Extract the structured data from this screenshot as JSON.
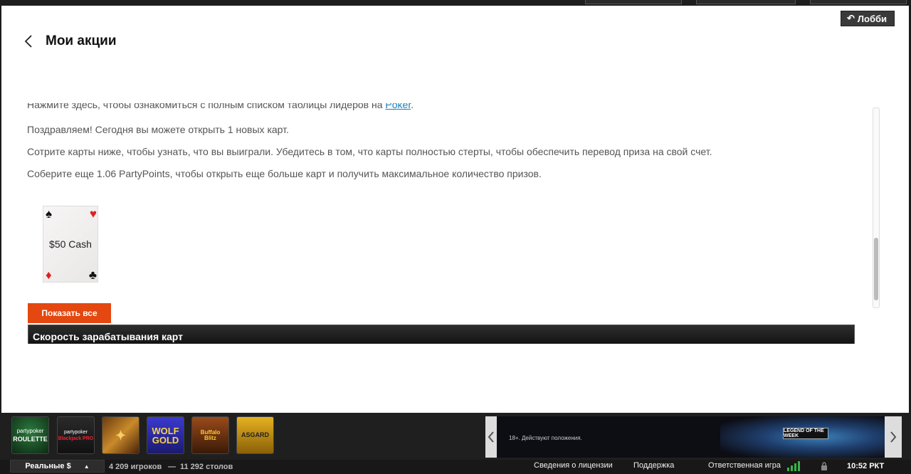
{
  "header": {
    "lobby_label": "Лобби",
    "title": "Мои акции"
  },
  "content": {
    "leaderboard_text": "Нажмите здесь, чтобы ознакомиться с полным списком таблицы лидеров на ",
    "leaderboard_link": "Poker",
    "leaderboard_suffix": ".",
    "congrats": "Поздравляем! Сегодня вы можете открыть 1 новых карт.",
    "instructions": "Сотрите карты ниже, чтобы узнать, что вы выиграли. Убедитесь в том, что карты полностью стерты, чтобы обеспечить перевод приза на свой счет.",
    "collect_more": "Соберите еще 1.06 PartyPoints, чтобы открыть еще больше карт и получить максимальное количество призов.",
    "card_prize": "$50 Cash",
    "show_all_label": "Показать все",
    "section_title": "Скорость зарабатывания карт"
  },
  "games": [
    {
      "name": "partypoker ROULETTE",
      "line1": "partypoker",
      "line2": "ROULETTE",
      "icon": "roulette-icon"
    },
    {
      "name": "partypoker Blackjack PRO",
      "line1": "partypoker",
      "line2": "Blackjack PRO",
      "icon": "blackjack-icon"
    },
    {
      "name": "slot-game-3",
      "line1": "",
      "line2": "",
      "icon": "slot-icon"
    },
    {
      "name": "Wolf Gold",
      "line1": "WOLF",
      "line2": "GOLD",
      "icon": "wolf-gold-icon"
    },
    {
      "name": "Buffalo Blitz",
      "line1": "Buffalo",
      "line2": "Blitz",
      "icon": "buffalo-blitz-icon"
    },
    {
      "name": "Asgard",
      "line1": "ASGARD",
      "line2": "",
      "icon": "asgard-icon"
    }
  ],
  "banner": {
    "disclaimer": "18+. Действуют положения.",
    "promo": "LEGEND OF THE WEEK"
  },
  "status": {
    "mode": "Реальные $",
    "players": "4 209 игроков",
    "dash": "—",
    "tables": "11 292 столов",
    "license": "Сведения о лицензии",
    "support": "Поддержка",
    "responsible": "Ответственная игра",
    "time": "10:52 РКТ"
  },
  "colors": {
    "accent": "#e4470f",
    "link": "#1a7fb8",
    "signal": "#3ab34a"
  }
}
